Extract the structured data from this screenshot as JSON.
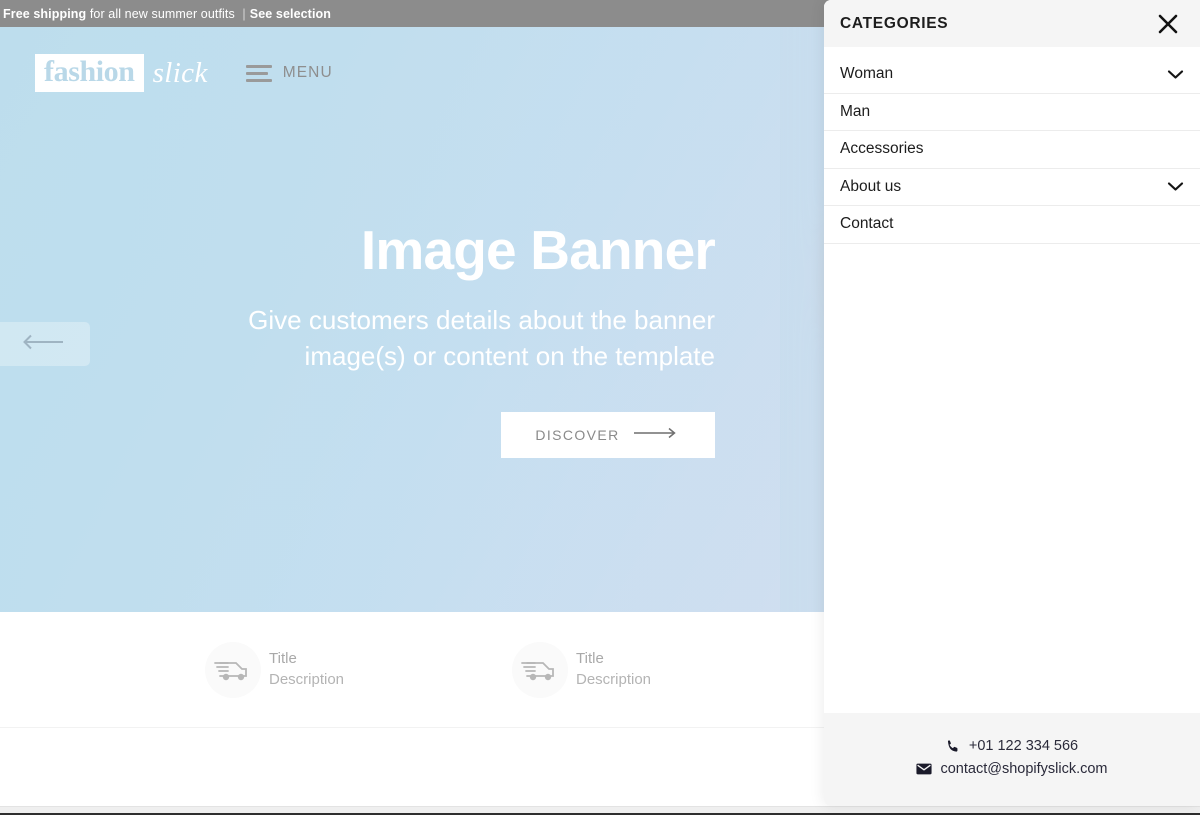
{
  "announcement": {
    "bold_lead": "Free shipping",
    "middle": " for all new summer outfits ",
    "separator": "|",
    "link": "See selection"
  },
  "header": {
    "logo_mark": "fashion",
    "logo_script": "slick",
    "menu_label": "MENU",
    "burger_icon": "hamburger-icon"
  },
  "hero": {
    "title": "Image Banner",
    "subtitle": "Give customers details about the banner image(s) or content on the template",
    "cta_label": "DISCOVER",
    "cta_icon": "arrow-right-icon",
    "prev_icon": "arrow-left-icon"
  },
  "features": [
    {
      "icon": "shipping-truck-icon",
      "title": "Title",
      "description": "Description"
    },
    {
      "icon": "shipping-truck-icon",
      "title": "Title",
      "description": "Description"
    }
  ],
  "drawer": {
    "title": "CATEGORIES",
    "close_icon": "close-icon",
    "items": [
      {
        "label": "Woman",
        "chevron": "chevron-down-icon",
        "expandable": true
      },
      {
        "label": "Man",
        "chevron": "",
        "expandable": false
      },
      {
        "label": "Accessories",
        "chevron": "",
        "expandable": false
      },
      {
        "label": "About us",
        "chevron": "chevron-down-icon",
        "expandable": true
      },
      {
        "label": "Contact",
        "chevron": "",
        "expandable": false
      }
    ],
    "footer": {
      "phone_icon": "phone-icon",
      "phone": "+01 122 334 566",
      "email_icon": "envelope-icon",
      "email": "contact@shopifyslick.com"
    }
  },
  "colors": {
    "announcement_bg": "#8c8c8c",
    "hero_gradient_start": "#bcdcec",
    "hero_gradient_end": "#c3d9e4",
    "drawer_header_bg": "#f5f5f5",
    "drawer_footer_bg": "#f5f5f5",
    "text_dark": "#1c1c1c",
    "muted_text": "#a9a9a9"
  }
}
